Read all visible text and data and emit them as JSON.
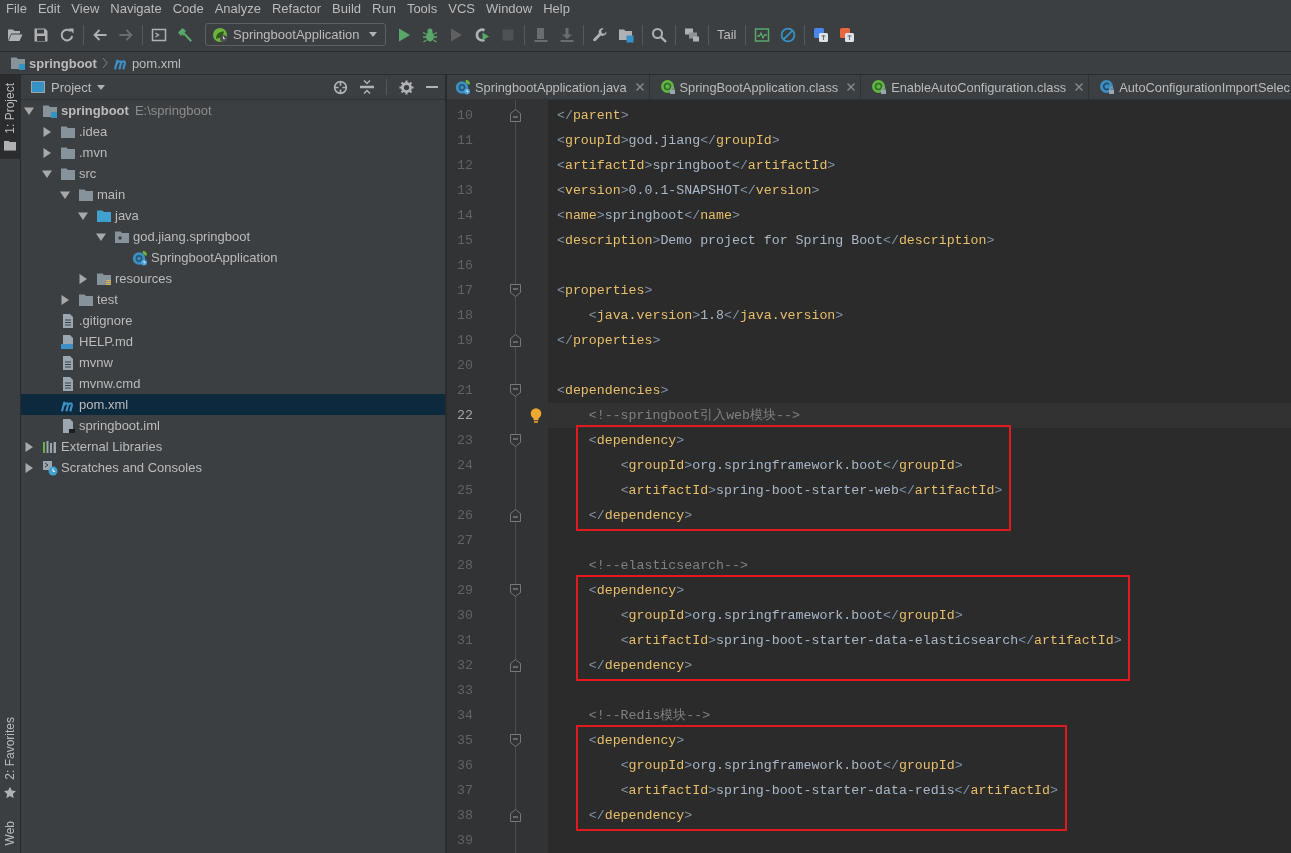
{
  "menu_bar": {
    "items": [
      "File",
      "Edit",
      "View",
      "Navigate",
      "Code",
      "Analyze",
      "Refactor",
      "Build",
      "Run",
      "Tools",
      "VCS",
      "Window",
      "Help"
    ]
  },
  "toolbar": {
    "groups": [
      [
        {
          "kind": "icon",
          "disabled": false
        },
        {
          "kind": "icon",
          "disabled": false
        },
        {
          "kind": "icon",
          "disabled": false
        }
      ],
      [
        {
          "kind": "icon",
          "disabled": false
        },
        {
          "kind": "icon",
          "disabled": true
        }
      ],
      [
        {
          "kind": "icon",
          "disabled": false
        },
        {
          "kind": "icon",
          "disabled": false
        },
        {
          "kind": "dropdown",
          "label": "SpringbootApplication"
        },
        {
          "kind": "icon",
          "disabled": false
        },
        {
          "kind": "icon",
          "disabled": false
        },
        {
          "kind": "icon",
          "disabled": true
        },
        {
          "kind": "icon",
          "disabled": false
        },
        {
          "kind": "icon",
          "disabled": true
        }
      ],
      [
        {
          "kind": "icon",
          "disabled": true
        },
        {
          "kind": "icon",
          "disabled": true
        }
      ],
      [
        {
          "kind": "icon",
          "disabled": false
        },
        {
          "kind": "icon",
          "disabled": false
        }
      ],
      [
        {
          "kind": "icon",
          "disabled": false
        }
      ],
      [
        {
          "kind": "icon",
          "disabled": false
        }
      ],
      [
        {
          "kind": "text",
          "label": "Tail"
        }
      ],
      [
        {
          "kind": "icon",
          "disabled": false
        },
        {
          "kind": "icon",
          "disabled": false
        }
      ],
      [
        {
          "kind": "icon",
          "disabled": false
        },
        {
          "kind": "icon",
          "disabled": false
        }
      ]
    ]
  },
  "breadcrumbs": [
    {
      "label": "springboot",
      "kind": "module"
    },
    {
      "label": "pom.xml",
      "kind": "maven"
    }
  ],
  "tool_strip": {
    "top": [
      {
        "label": "1: Project",
        "kind": "project",
        "selected": true
      }
    ],
    "bottom": [
      {
        "label": "2: Favorites",
        "kind": "favorites",
        "selected": false
      },
      {
        "label": "Web",
        "kind": "web",
        "selected": false
      }
    ]
  },
  "project_panel": {
    "title": "Project",
    "tree": [
      {
        "label": "springboot",
        "path": "E:\\springboot",
        "kind": "module",
        "expanded": true,
        "selected": false,
        "children": [
          {
            "label": ".idea",
            "kind": "folder",
            "expanded": false,
            "selected": false
          },
          {
            "label": ".mvn",
            "kind": "folder",
            "expanded": false,
            "selected": false
          },
          {
            "label": "src",
            "kind": "folder",
            "expanded": true,
            "selected": false,
            "children": [
              {
                "label": "main",
                "kind": "folder",
                "expanded": true,
                "selected": false,
                "children": [
                  {
                    "label": "java",
                    "kind": "source-folder",
                    "expanded": true,
                    "selected": false,
                    "children": [
                      {
                        "label": "god.jiang.springboot",
                        "kind": "package",
                        "expanded": true,
                        "selected": false,
                        "children": [
                          {
                            "label": "SpringbootApplication",
                            "kind": "spring-class",
                            "selected": false
                          }
                        ]
                      }
                    ]
                  },
                  {
                    "label": "resources",
                    "kind": "resources-folder",
                    "expanded": false,
                    "selected": false
                  }
                ]
              },
              {
                "label": "test",
                "kind": "folder",
                "expanded": false,
                "selected": false
              }
            ]
          },
          {
            "label": ".gitignore",
            "kind": "text-file",
            "selected": false
          },
          {
            "label": "HELP.md",
            "kind": "markdown",
            "selected": false
          },
          {
            "label": "mvnw",
            "kind": "text-file",
            "selected": false
          },
          {
            "label": "mvnw.cmd",
            "kind": "text-file",
            "selected": false
          },
          {
            "label": "pom.xml",
            "kind": "maven",
            "selected": true
          },
          {
            "label": "springboot.iml",
            "kind": "iml",
            "selected": false
          }
        ]
      },
      {
        "label": "External Libraries",
        "kind": "libraries",
        "expanded": false,
        "selected": false
      },
      {
        "label": "Scratches and Consoles",
        "kind": "scratches",
        "expanded": false,
        "selected": false
      }
    ]
  },
  "editor": {
    "tabs": [
      {
        "label": "SpringbootApplication.java",
        "kind": "spring-class",
        "selected": false,
        "closable": true
      },
      {
        "label": "SpringBootApplication.class",
        "kind": "annotation",
        "selected": false,
        "closable": true
      },
      {
        "label": "EnableAutoConfiguration.class",
        "kind": "annotation",
        "selected": false,
        "closable": true
      },
      {
        "label": "AutoConfigurationImportSelec",
        "kind": "class",
        "selected": false,
        "closable": false
      }
    ],
    "lines": [
      {
        "number": "10",
        "text": "</parent>",
        "fold_start": false,
        "fold_end": true,
        "current": false,
        "boxed": false
      },
      {
        "number": "11",
        "text": "<groupId>god.jiang</groupId>",
        "fold_start": false,
        "fold_end": false,
        "current": false,
        "boxed": false
      },
      {
        "number": "12",
        "text": "<artifactId>springboot</artifactId>",
        "fold_start": false,
        "fold_end": false,
        "current": false,
        "boxed": false
      },
      {
        "number": "13",
        "text": "<version>0.0.1-SNAPSHOT</version>",
        "fold_start": false,
        "fold_end": false,
        "current": false,
        "boxed": false
      },
      {
        "number": "14",
        "text": "<name>springboot</name>",
        "fold_start": false,
        "fold_end": false,
        "current": false,
        "boxed": false
      },
      {
        "number": "15",
        "text": "<description>Demo project for Spring Boot</description>",
        "fold_start": false,
        "fold_end": false,
        "current": false,
        "boxed": false
      },
      {
        "number": "16",
        "fold_start": false,
        "fold_end": false,
        "current": false,
        "boxed": false
      },
      {
        "number": "17",
        "text": "<properties>",
        "fold_start": true,
        "fold_end": false,
        "current": false,
        "boxed": false
      },
      {
        "number": "18",
        "text": "    <java.version>1.8</java.version>",
        "fold_start": false,
        "fold_end": false,
        "current": false,
        "boxed": false
      },
      {
        "number": "19",
        "text": "</properties>",
        "fold_start": false,
        "fold_end": true,
        "current": false,
        "boxed": false
      },
      {
        "number": "20",
        "fold_start": false,
        "fold_end": false,
        "current": false,
        "boxed": false
      },
      {
        "number": "21",
        "text": "<dependencies>",
        "fold_start": true,
        "fold_end": false,
        "current": false,
        "boxed": false
      },
      {
        "number": "22",
        "text": "    <!--springboot引入web模块-->",
        "fold_start": false,
        "fold_end": false,
        "current": true,
        "boxed": false
      },
      {
        "number": "23",
        "text": "    <dependency>",
        "fold_start": true,
        "fold_end": false,
        "current": false,
        "boxed": true
      },
      {
        "number": "24",
        "text": "        <groupId>org.springframework.boot</groupId>",
        "fold_start": false,
        "fold_end": false,
        "current": false,
        "boxed": true
      },
      {
        "number": "25",
        "text": "        <artifactId>spring-boot-starter-web</artifactId>",
        "fold_start": false,
        "fold_end": false,
        "current": false,
        "boxed": true
      },
      {
        "number": "26",
        "text": "    </dependency>",
        "fold_start": false,
        "fold_end": true,
        "current": false,
        "boxed": true
      },
      {
        "number": "27",
        "fold_start": false,
        "fold_end": false,
        "current": false,
        "boxed": false
      },
      {
        "number": "28",
        "text": "    <!--elasticsearch-->",
        "fold_start": false,
        "fold_end": false,
        "current": false,
        "boxed": false
      },
      {
        "number": "29",
        "text": "    <dependency>",
        "fold_start": true,
        "fold_end": false,
        "current": false,
        "boxed": true
      },
      {
        "number": "30",
        "text": "        <groupId>org.springframework.boot</groupId>",
        "fold_start": false,
        "fold_end": false,
        "current": false,
        "boxed": true
      },
      {
        "number": "31",
        "text": "        <artifactId>spring-boot-starter-data-elasticsearch</artifactId>",
        "fold_start": false,
        "fold_end": false,
        "current": false,
        "boxed": true
      },
      {
        "number": "32",
        "text": "    </dependency>",
        "fold_start": false,
        "fold_end": true,
        "current": false,
        "boxed": true
      },
      {
        "number": "33",
        "fold_start": false,
        "fold_end": false,
        "current": false,
        "boxed": false
      },
      {
        "number": "34",
        "text": "    <!--Redis模块-->",
        "fold_start": false,
        "fold_end": false,
        "current": false,
        "boxed": false
      },
      {
        "number": "35",
        "text": "    <dependency>",
        "fold_start": true,
        "fold_end": false,
        "current": false,
        "boxed": true
      },
      {
        "number": "36",
        "text": "        <groupId>org.springframework.boot</groupId>",
        "fold_start": false,
        "fold_end": false,
        "current": false,
        "boxed": true
      },
      {
        "number": "37",
        "text": "        <artifactId>spring-boot-starter-data-redis</artifactId>",
        "fold_start": false,
        "fold_end": false,
        "current": false,
        "boxed": true
      },
      {
        "number": "38",
        "text": "    </dependency>",
        "fold_start": false,
        "fold_end": true,
        "current": false,
        "boxed": true
      },
      {
        "number": "39",
        "fold_start": false,
        "fold_end": false,
        "current": false,
        "boxed": false
      }
    ]
  }
}
